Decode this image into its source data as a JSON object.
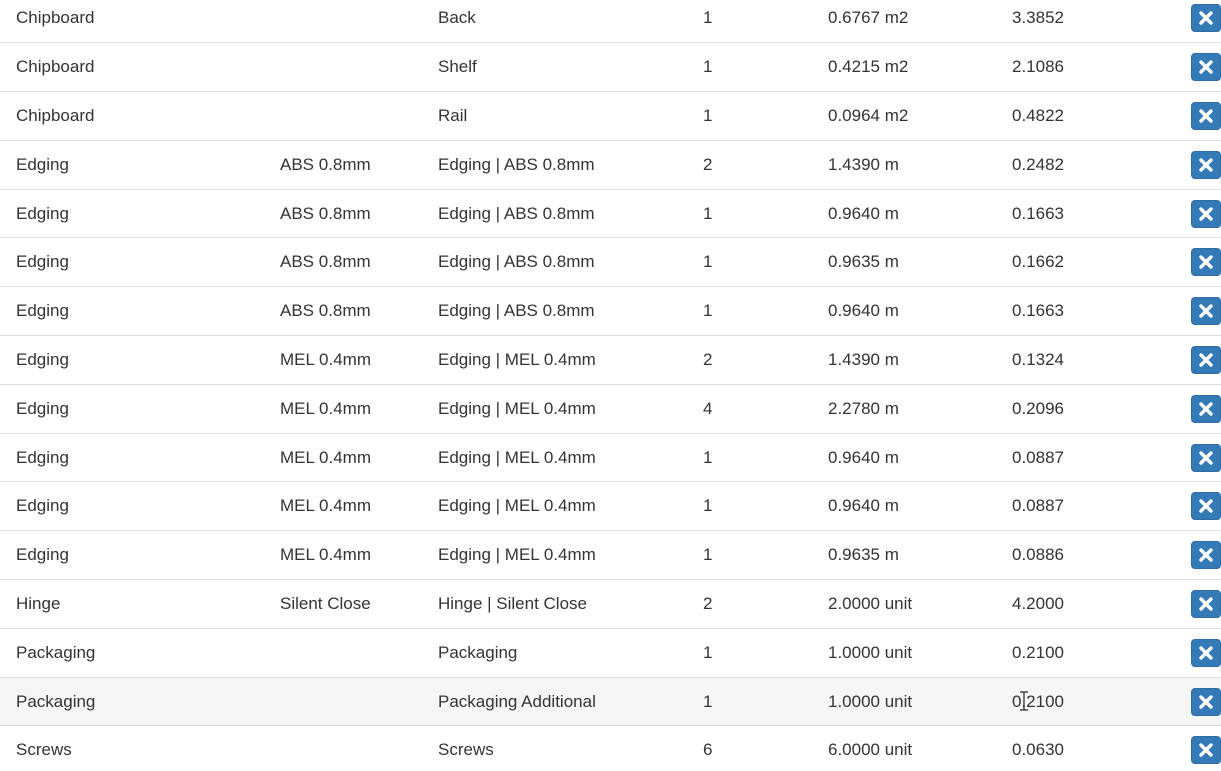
{
  "table": {
    "rows": [
      {
        "category": "Chipboard",
        "variant": "",
        "description": "Back",
        "qty": "1",
        "amount": "0.6767 m2",
        "price": "3.3852"
      },
      {
        "category": "Chipboard",
        "variant": "",
        "description": "Shelf",
        "qty": "1",
        "amount": "0.4215 m2",
        "price": "2.1086"
      },
      {
        "category": "Chipboard",
        "variant": "",
        "description": "Rail",
        "qty": "1",
        "amount": "0.0964 m2",
        "price": "0.4822"
      },
      {
        "category": "Edging",
        "variant": "ABS 0.8mm",
        "description": "Edging | ABS 0.8mm",
        "qty": "2",
        "amount": "1.4390 m",
        "price": "0.2482"
      },
      {
        "category": "Edging",
        "variant": "ABS 0.8mm",
        "description": "Edging | ABS 0.8mm",
        "qty": "1",
        "amount": "0.9640 m",
        "price": "0.1663"
      },
      {
        "category": "Edging",
        "variant": "ABS 0.8mm",
        "description": "Edging | ABS 0.8mm",
        "qty": "1",
        "amount": "0.9635 m",
        "price": "0.1662"
      },
      {
        "category": "Edging",
        "variant": "ABS 0.8mm",
        "description": "Edging | ABS 0.8mm",
        "qty": "1",
        "amount": "0.9640 m",
        "price": "0.1663"
      },
      {
        "category": "Edging",
        "variant": "MEL 0.4mm",
        "description": "Edging | MEL 0.4mm",
        "qty": "2",
        "amount": "1.4390 m",
        "price": "0.1324"
      },
      {
        "category": "Edging",
        "variant": "MEL 0.4mm",
        "description": "Edging | MEL 0.4mm",
        "qty": "4",
        "amount": "2.2780 m",
        "price": "0.2096"
      },
      {
        "category": "Edging",
        "variant": "MEL 0.4mm",
        "description": "Edging | MEL 0.4mm",
        "qty": "1",
        "amount": "0.9640 m",
        "price": "0.0887"
      },
      {
        "category": "Edging",
        "variant": "MEL 0.4mm",
        "description": "Edging | MEL 0.4mm",
        "qty": "1",
        "amount": "0.9640 m",
        "price": "0.0887"
      },
      {
        "category": "Edging",
        "variant": "MEL 0.4mm",
        "description": "Edging | MEL 0.4mm",
        "qty": "1",
        "amount": "0.9635 m",
        "price": "0.0886"
      },
      {
        "category": "Hinge",
        "variant": "Silent Close",
        "description": "Hinge | Silent Close",
        "qty": "2",
        "amount": "2.0000 unit",
        "price": "4.2000"
      },
      {
        "category": "Packaging",
        "variant": "",
        "description": "Packaging",
        "qty": "1",
        "amount": "1.0000 unit",
        "price": "0.2100"
      },
      {
        "category": "Packaging",
        "variant": "",
        "description": "Packaging Additional",
        "qty": "1",
        "amount": "1.0000 unit",
        "price": "0.2100",
        "hovered": true
      },
      {
        "category": "Screws",
        "variant": "",
        "description": "Screws",
        "qty": "6",
        "amount": "6.0000 unit",
        "price": "0.0630"
      }
    ],
    "remove_icon": "close-icon",
    "colors": {
      "button_bg": "#337ab7",
      "button_border": "#2e6da4",
      "row_border": "#dddddd",
      "hover_row": "#f5f5f5",
      "text": "#333333"
    }
  }
}
